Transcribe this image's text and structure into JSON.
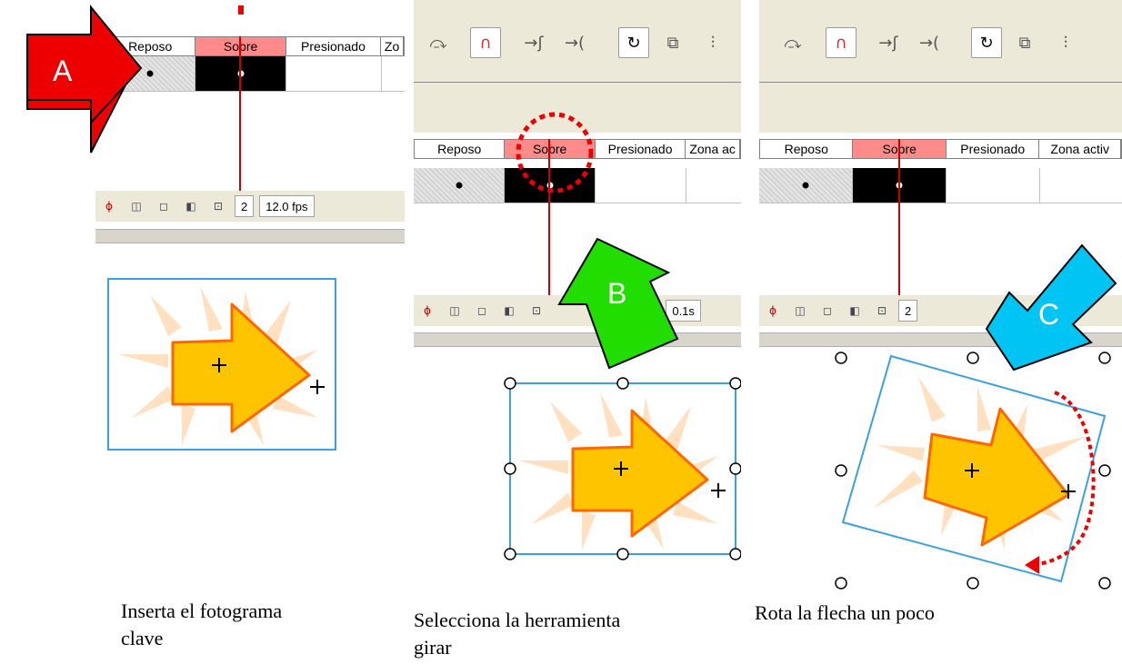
{
  "timeline": {
    "tabs": [
      "Reposo",
      "Sobre",
      "Presionado",
      "Zona activa"
    ],
    "tabs_panel1": [
      "Reposo",
      "Sobre",
      "Presionado",
      "Zo"
    ],
    "tabs_panel2": [
      "Reposo",
      "Sobre",
      "Presionado",
      "Zona ac"
    ],
    "tabs_panel3": [
      "Reposo",
      "Sobre",
      "Presionado",
      "Zona activ"
    ],
    "frame_number": "2",
    "fps_full": "12.0 fps",
    "fps_partial": "fps",
    "time_partial": "0.1s"
  },
  "callouts": {
    "a": "A",
    "b": "B",
    "c": "C"
  },
  "captions": {
    "step1": [
      "Inserta el fotograma",
      "clave"
    ],
    "step2": [
      "Selecciona la herramienta",
      "girar"
    ],
    "step3": "Rota la flecha un poco"
  },
  "colors": {
    "selected_tab": "#ff8a8a",
    "playhead": "#cc0000",
    "callout_a": "#ee0000",
    "callout_b": "#22dd00",
    "callout_c": "#00c4f4",
    "arrow_fill": "#ffc400",
    "arrow_stroke": "#ff6600",
    "burst": "#ffe0c0",
    "bounding_box": "#3aa0e0"
  },
  "icons": [
    "loop-icon",
    "snap-magnet-icon",
    "smooth-icon",
    "straighten-icon",
    "rotate-icon",
    "scale-icon",
    "align-icon"
  ]
}
